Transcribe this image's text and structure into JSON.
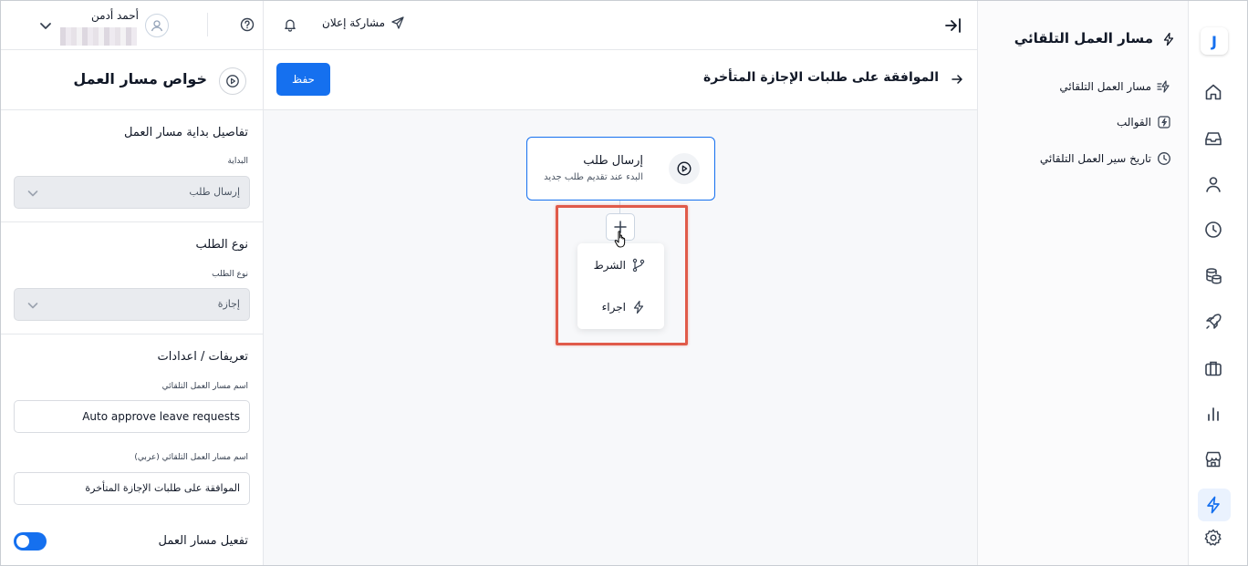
{
  "user": {
    "name": "أحمد أدمن"
  },
  "topbar": {
    "share_label": "مشاركة إعلان"
  },
  "properties": {
    "title": "خواص مسار العمل",
    "start_section": "تفاصيل بداية مسار العمل",
    "start_label": "البداية",
    "start_value": "إرسال طلب",
    "request_section": "نوع الطلب",
    "request_label": "نوع الطلب",
    "request_value": "إجازة",
    "settings_section": "تعريفات / اعدادات",
    "name_label": "اسم مسار العمل التلقائي",
    "name_value": "Auto approve leave requests",
    "name_ar_label": "اسم مسار العمل التلقائي (عربي)",
    "name_ar_value": "الموافقة على طلبات الإجازة المتأخرة",
    "enable_label": "تفعيل مسار العمل",
    "enabled": true
  },
  "canvas": {
    "save_label": "حفظ",
    "workflow_title": "الموافقة على طلبات الإجازة المتأخرة",
    "trigger_node": {
      "title": "إرسال طلب",
      "subtitle": "البدء عند تقديم طلب جديد"
    },
    "add_menu": [
      {
        "label": "الشرط",
        "icon": "branch-icon"
      },
      {
        "label": "اجراء",
        "icon": "bolt-icon"
      }
    ],
    "highlight_color": "#e05b4a"
  },
  "nav": {
    "title": "مسار العمل التلقائي",
    "items": [
      {
        "label": "مسار العمل التلقائي",
        "icon": "bolt-list-icon"
      },
      {
        "label": "القوالب",
        "icon": "template-icon"
      },
      {
        "label": "تاريخ سير العمل التلقائي",
        "icon": "clock-icon"
      }
    ]
  },
  "rail": {
    "logo": "J",
    "icons": [
      "home-icon",
      "inbox-icon",
      "user-icon",
      "clock-icon",
      "coins-icon",
      "rocket-icon",
      "briefcase-icon",
      "chart-icon",
      "store-icon",
      "bolt-icon",
      "settings-icon"
    ],
    "active": "bolt-icon"
  },
  "colors": {
    "accent": "#1570ef",
    "active_bg": "#eaf2fe"
  }
}
